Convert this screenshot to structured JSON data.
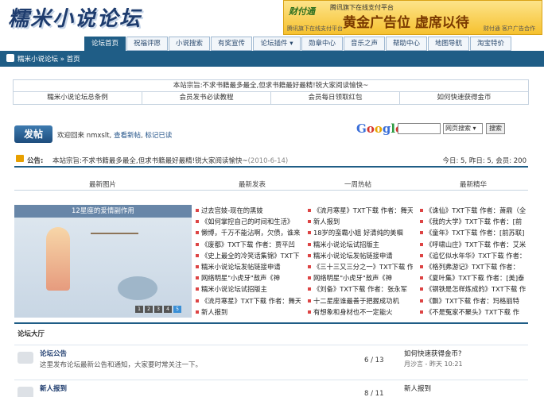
{
  "logo_text": "糯米小说论坛",
  "ad": {
    "brand": "财付通",
    "brand_sub": "腾讯旗下在线支付平台",
    "big": "黄金广告位 虚席以待",
    "footer": "财付通 客户广告合作",
    "small": "腾讯旗下在线支付平台"
  },
  "nav": [
    {
      "label": "论坛首页",
      "active": true
    },
    {
      "label": "祝福评愿"
    },
    {
      "label": "小说搜索"
    },
    {
      "label": "有奖宣传"
    },
    {
      "label": "论坛插件 ▾"
    },
    {
      "label": "勋章中心"
    },
    {
      "label": "音乐之声"
    },
    {
      "label": "帮助中心"
    },
    {
      "label": "地图导航"
    },
    {
      "label": "淘宝特价"
    }
  ],
  "breadcrumb": "糯米小说论坛 » 首页",
  "notice_table": {
    "purpose": "本站宗旨:不求书籍最多最全,但求书籍最好最精!锐大家阅读愉快~",
    "links": [
      "糯米小说论坛总条例",
      "会员发书必读教程",
      "会员每日领取红包",
      "如何快速获得金币"
    ]
  },
  "post_button": "发帖",
  "welcome": {
    "prefix": "欢迎回来",
    "user": "nmxslt,",
    "l1": "查看新帖",
    "l2": "标记已读"
  },
  "google": {
    "logo": "Google",
    "select": "网页搜索 ▾",
    "button": "搜索"
  },
  "announcement": {
    "label": "公告:",
    "text": "本站宗旨:不求书籍最多最全,但求书籍最好最精!锐大家阅读愉快~",
    "date": "(2010-6-14)",
    "stats": "今日: 5, 昨日: 5, 会员: 200"
  },
  "section_heads": [
    "最新图片",
    "最新发表",
    "一周热帖",
    "最新精华"
  ],
  "slideshow": {
    "caption": "12星座的爱情副作用",
    "pages": [
      "1",
      "2",
      "3",
      "4",
      "5"
    ]
  },
  "lists": {
    "latest": [
      "过去宫妓-现在的黑妓",
      "《如何掌控自己的时间和生活》",
      "懒博，千万不能沾啊，欠债，谁来",
      "《废都》TXT下载 作者：贾平凹",
      "《史上最全的冷笑话集锦》TXT下",
      "糯米小说论坛发帖链接申请",
      "网络明星\"小虎牙\"敖声《神",
      "糯米小说论坛试招版主",
      "《流月寒星》TXT下载 作者：舞天",
      "新人报到"
    ],
    "hot": [
      "《流月寒星》TXT下载 作者：舞天",
      "新人报到",
      "18岁的蛮霸小姐 好清纯的美帼",
      "糯米小说论坛试招版主",
      "糯米小说论坛发帖链接申请",
      "《三十三又三分之一》TXT下载 作",
      "网络明星\"小虎牙\"敖声《神",
      "《刘备》TXT下载 作者：张永军",
      "十二星座谁最善于把握成功机",
      "有想象和身材也不一定能火"
    ],
    "elite": [
      "《诛仙》TXT下载 作者：萧鼎（全",
      "《我的大学》TXT下载 作者：[前",
      "《童年》TXT下载 作者：[前苏联]",
      "《呼啸山庄》TXT下载 作者：艾米",
      "《追忆似水年华》TXT下载 作者：",
      "《格列弗游记》TXT下载 作者：",
      "《夏叶集》TXT下载 作者：[美]泰",
      "《钢铁是怎样炼成的》TXT下载 作",
      "《飘》TXT下载 作者：玛格丽特",
      "《不是冤家不聚头》TXT下载 作"
    ]
  },
  "forum_section": "论坛大厅",
  "forums": [
    {
      "name": "论坛公告",
      "desc": "这里发布论坛最新公告和通知，大家要时常关注一下。",
      "stats": "6 / 13",
      "last_title": "如何快速获得金币?",
      "last_meta": "月沙言 - 昨天 10:21"
    },
    {
      "name": "新人报到",
      "desc": "",
      "stats": "8 / 11",
      "last_title": "新人报到",
      "last_meta": ""
    }
  ]
}
